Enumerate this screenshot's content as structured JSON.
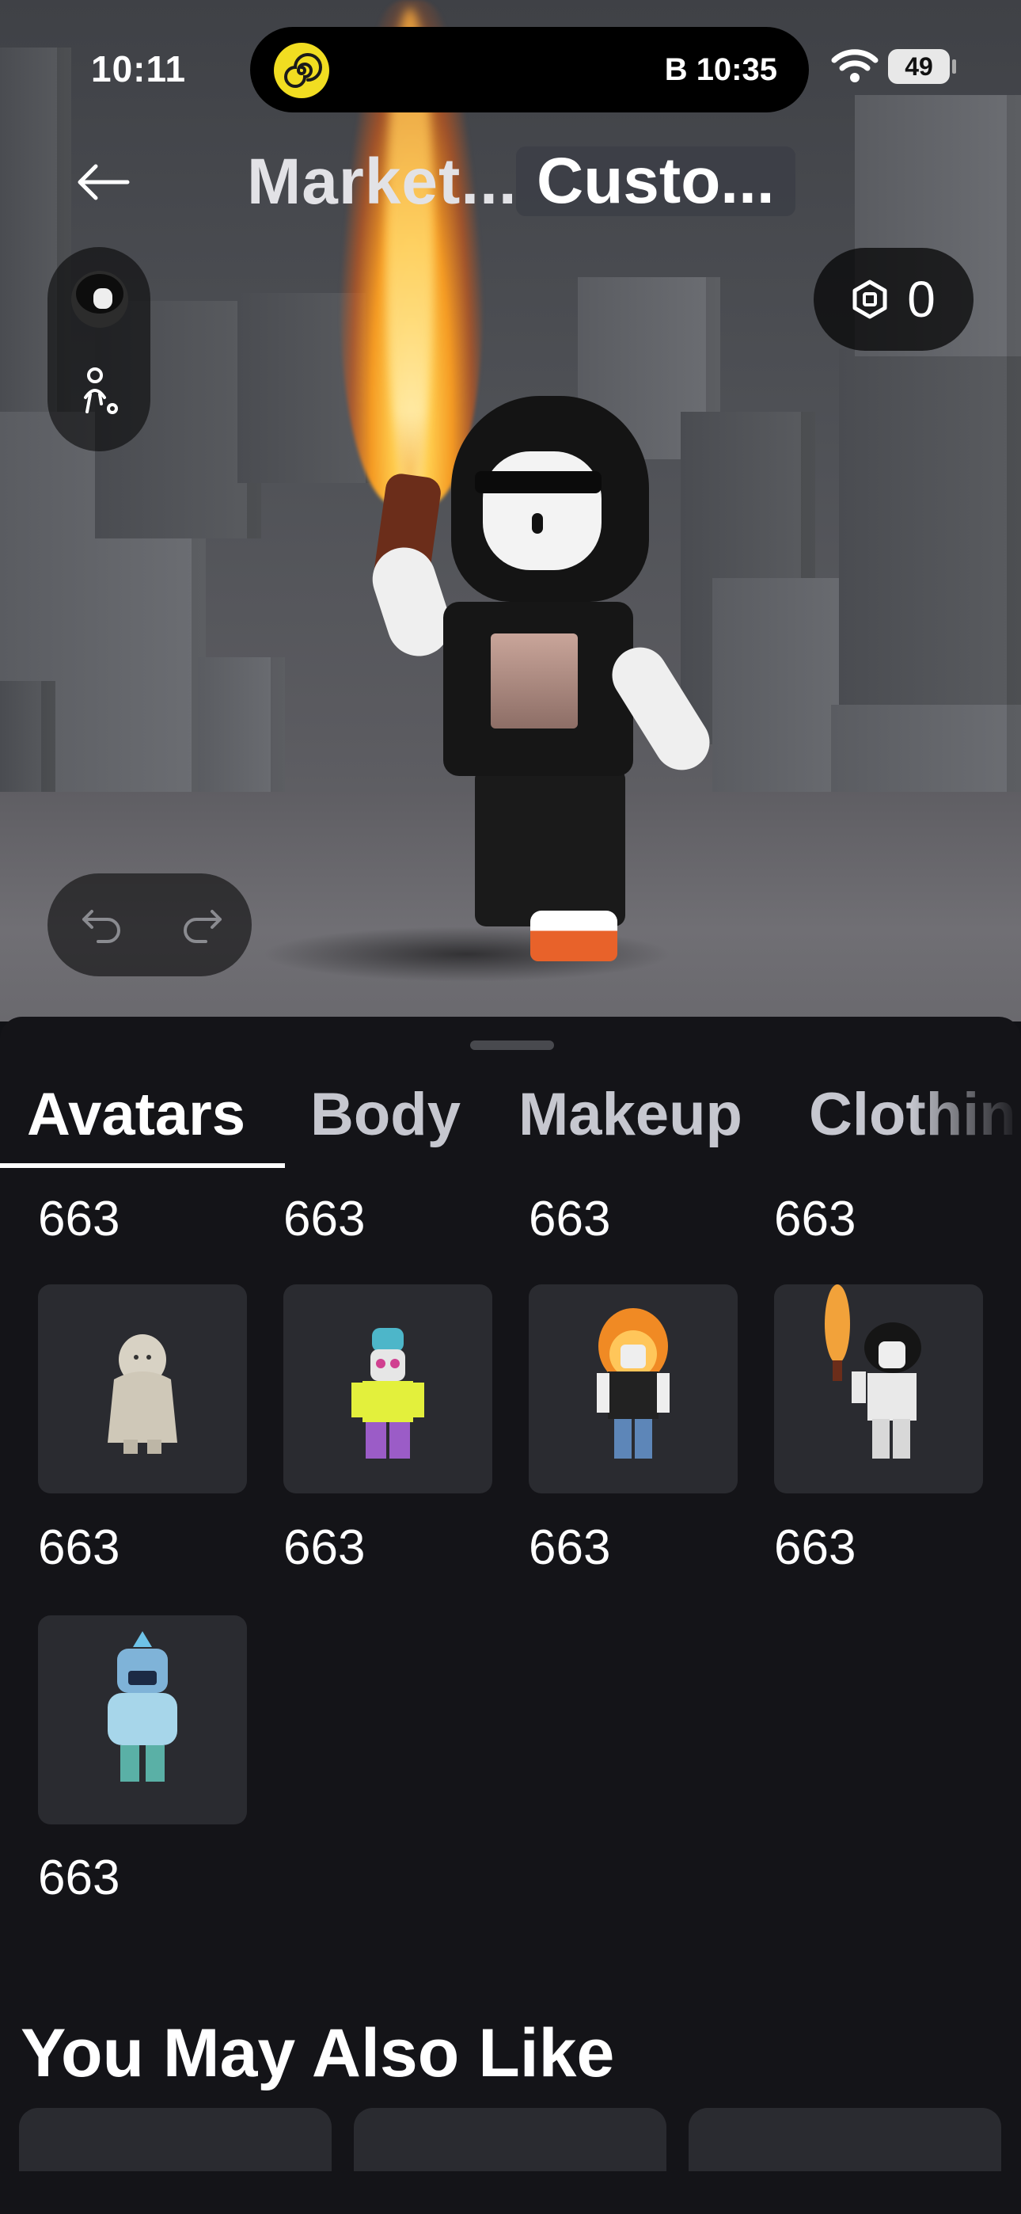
{
  "status_bar": {
    "time": "10:11",
    "live_activity_text": "B 10:35",
    "battery": "49"
  },
  "header": {
    "tab_marketplace": "Market...",
    "tab_customize": "Custo..."
  },
  "currency": {
    "robux_balance": "0"
  },
  "category_tabs": [
    "Avatars",
    "Body",
    "Makeup",
    "Clothin"
  ],
  "items": {
    "row0_prices": [
      "663",
      "663",
      "663",
      "663"
    ],
    "row1_prices": [
      "663",
      "663",
      "663",
      "663"
    ],
    "row2_prices": [
      "663"
    ]
  },
  "recommendations": {
    "title": "You May Also Like"
  },
  "colors": {
    "sheet_bg": "#141418",
    "tile_bg": "#2a2b30",
    "accent": "#f1dd21"
  }
}
